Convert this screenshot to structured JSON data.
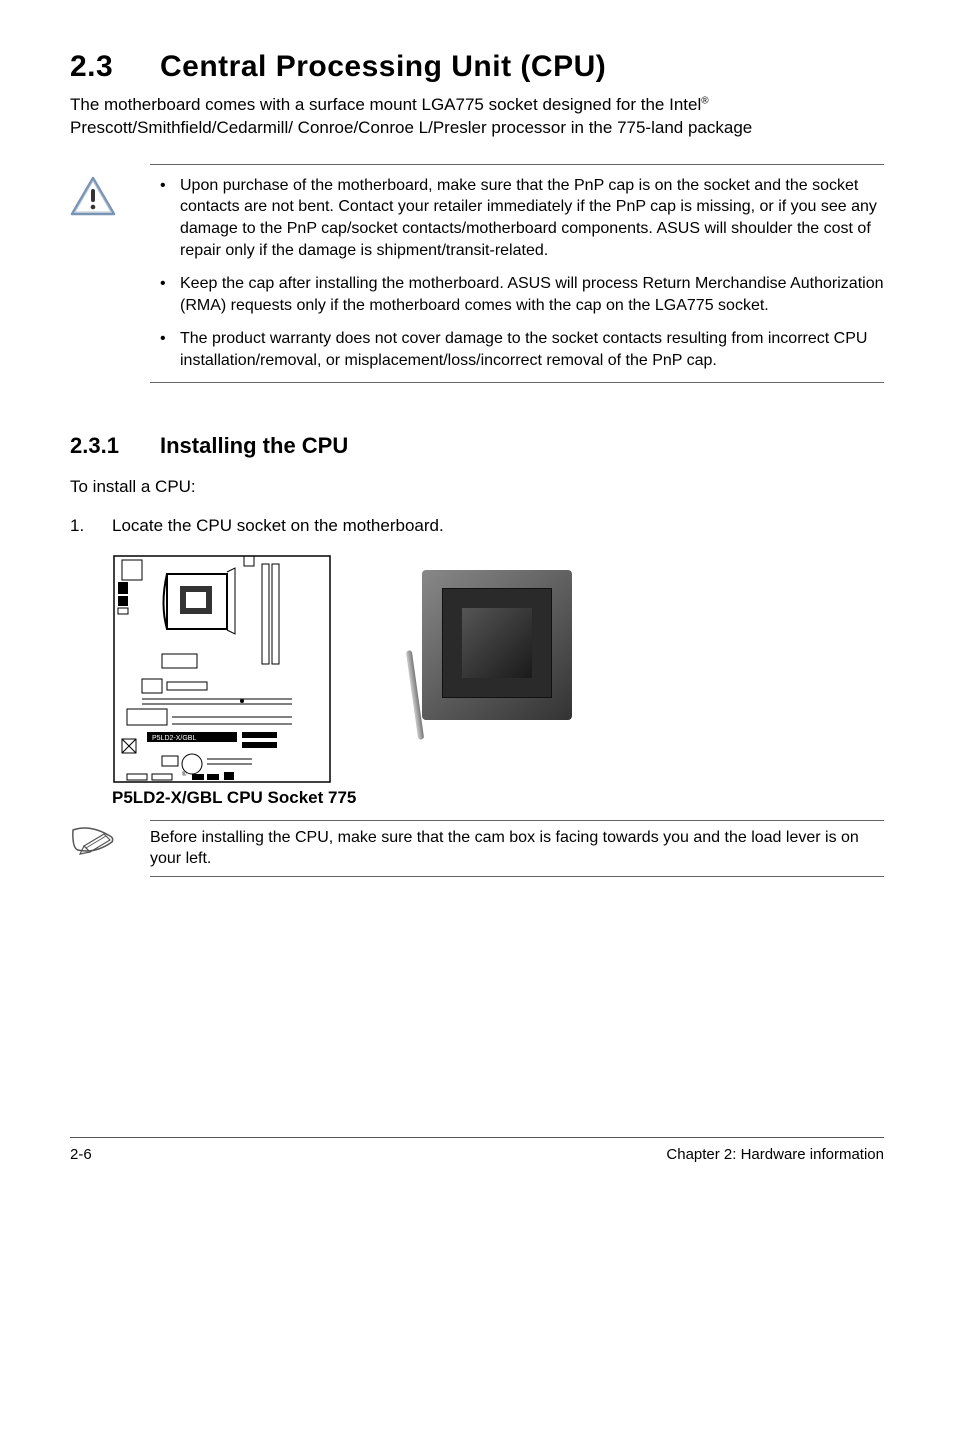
{
  "section": {
    "number": "2.3",
    "title": "Central Processing Unit (CPU)",
    "intro_before_sup": "The motherboard comes with a surface mount LGA775 socket designed for the Intel",
    "intro_sup": "®",
    "intro_after_sup": " Prescott/Smithfield/Cedarmill/ Conroe/Conroe L/Presler processor in the 775-land package"
  },
  "warnings": [
    "Upon purchase of the motherboard, make sure that the PnP cap is on the socket and the socket contacts are not bent. Contact your retailer immediately if the PnP cap is missing, or if you see any damage to the PnP cap/socket contacts/motherboard components. ASUS will shoulder the cost of repair only if the damage is shipment/transit-related.",
    "Keep the cap after installing the motherboard. ASUS will process Return Merchandise Authorization (RMA) requests only if the motherboard comes with the cap on the LGA775 socket.",
    "The product warranty does not cover damage to the socket contacts resulting from incorrect CPU installation/removal, or misplacement/loss/incorrect removal of the PnP cap."
  ],
  "subsection": {
    "number": "2.3.1",
    "title": "Installing the CPU",
    "lead": "To install a CPU:",
    "step1_number": "1.",
    "step1_text": "Locate the CPU socket on the motherboard."
  },
  "figure": {
    "board_label": "P5LD2-X/GBL",
    "caption": "P5LD2-X/GBL CPU Socket 775"
  },
  "note": "Before installing the CPU, make sure that the cam box is facing towards you and the load lever is on your left.",
  "footer": {
    "left": "2-6",
    "right": "Chapter 2: Hardware information"
  }
}
